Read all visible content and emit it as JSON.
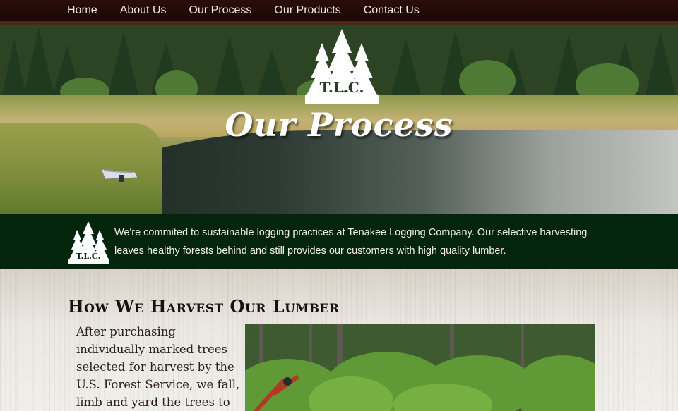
{
  "nav": {
    "items": [
      "Home",
      "About Us",
      "Our Process",
      "Our Products",
      "Contact Us"
    ]
  },
  "hero": {
    "logo_text": "T.L.C.",
    "title": "Our Process"
  },
  "tagline": {
    "logo_text": "T.L.C.",
    "text": "We're commited to sustainable logging practices at Tenakee Logging Company. Our selective harvesting leaves healthy forests behind and still provides our customers with high quality lumber."
  },
  "content": {
    "heading": "How We Harvest Our Lumber",
    "body": "After purchasing individually marked trees selected for harvest by the U.S. Forest Service, we fall, limb and yard the trees to the road where"
  },
  "colors": {
    "nav_bg": "#1c0704",
    "tagline_bg": "#03250c",
    "heading_text": "#1a1010"
  }
}
